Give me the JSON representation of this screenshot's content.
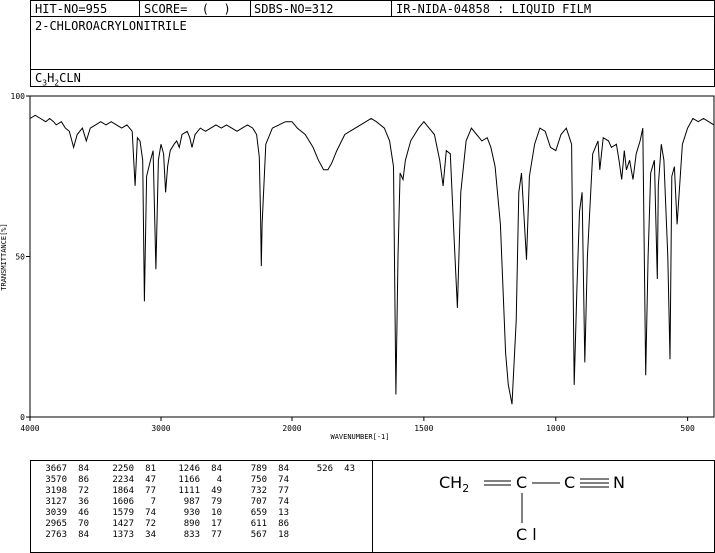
{
  "header": {
    "hit_no": "HIT-NO=955",
    "score": "SCORE=  (  )",
    "sdbs_no": "SDBS-NO=312",
    "ir_label": "IR-NIDA-04858 : LIQUID FILM",
    "compound_name": "2-CHLOROACRYLONITRILE",
    "formula": {
      "c": "C",
      "c_sub": "3",
      "h": "H",
      "h_sub": "2",
      "rest": "CLN"
    }
  },
  "chart_data": {
    "type": "line",
    "xlabel": "WAVENUMBER[-1]",
    "ylabel": "TRANSMITTANCE[%]",
    "xlim": [
      4000,
      400
    ],
    "ylim": [
      0,
      100
    ],
    "x_ticks": [
      4000,
      3000,
      2000,
      1500,
      1000,
      500
    ],
    "y_ticks": [
      0,
      50,
      100
    ],
    "series": [
      {
        "x": [
          4000,
          3960,
          3920,
          3880,
          3850,
          3820,
          3800,
          3760,
          3730,
          3700,
          3667,
          3640,
          3600,
          3570,
          3540,
          3500,
          3460,
          3420,
          3380,
          3340,
          3300,
          3260,
          3220,
          3198,
          3180,
          3160,
          3140,
          3127,
          3110,
          3080,
          3060,
          3039,
          3020,
          3000,
          2980,
          2965,
          2950,
          2930,
          2900,
          2880,
          2860,
          2840,
          2800,
          2780,
          2763,
          2740,
          2700,
          2660,
          2620,
          2580,
          2540,
          2500,
          2460,
          2420,
          2380,
          2340,
          2300,
          2270,
          2250,
          2240,
          2234,
          2228,
          2200,
          2150,
          2100,
          2050,
          2000,
          1980,
          1950,
          1920,
          1900,
          1880,
          1864,
          1850,
          1830,
          1800,
          1760,
          1720,
          1700,
          1680,
          1650,
          1630,
          1615,
          1606,
          1598,
          1590,
          1579,
          1570,
          1550,
          1520,
          1500,
          1480,
          1460,
          1440,
          1427,
          1415,
          1400,
          1385,
          1373,
          1360,
          1340,
          1320,
          1300,
          1280,
          1260,
          1246,
          1230,
          1210,
          1190,
          1180,
          1166,
          1150,
          1140,
          1130,
          1111,
          1100,
          1080,
          1060,
          1040,
          1020,
          1000,
          980,
          960,
          940,
          930,
          920,
          910,
          900,
          890,
          880,
          860,
          840,
          833,
          820,
          800,
          789,
          770,
          760,
          750,
          740,
          732,
          720,
          707,
          695,
          680,
          670,
          659,
          650,
          640,
          626,
          615,
          611,
          600,
          590,
          575,
          567,
          560,
          550,
          540,
          520,
          500,
          480,
          460,
          440,
          420,
          400
        ],
        "y": [
          93,
          94,
          93,
          92,
          93,
          92,
          91,
          92,
          90,
          89,
          84,
          88,
          90,
          86,
          90,
          91,
          92,
          91,
          92,
          91,
          90,
          91,
          89,
          72,
          87,
          86,
          80,
          36,
          75,
          80,
          83,
          46,
          80,
          85,
          82,
          70,
          78,
          83,
          85,
          86,
          84,
          88,
          89,
          87,
          84,
          88,
          90,
          89,
          90,
          91,
          90,
          91,
          90,
          89,
          90,
          91,
          90,
          88,
          81,
          62,
          47,
          60,
          85,
          90,
          91,
          92,
          92,
          90,
          88,
          84,
          80,
          77,
          77,
          79,
          83,
          88,
          90,
          92,
          93,
          92,
          90,
          86,
          78,
          7,
          50,
          76,
          74,
          80,
          86,
          90,
          92,
          90,
          88,
          80,
          72,
          83,
          82,
          55,
          34,
          70,
          86,
          90,
          88,
          86,
          87,
          84,
          78,
          60,
          20,
          10,
          4,
          30,
          70,
          76,
          49,
          75,
          85,
          90,
          89,
          84,
          83,
          88,
          90,
          85,
          10,
          40,
          64,
          70,
          17,
          50,
          82,
          86,
          77,
          87,
          86,
          84,
          85,
          80,
          74,
          83,
          77,
          80,
          74,
          82,
          86,
          90,
          13,
          50,
          76,
          80,
          43,
          72,
          85,
          80,
          50,
          18,
          75,
          78,
          60,
          85,
          90,
          93,
          92,
          93,
          92,
          91
        ]
      }
    ]
  },
  "peak_table": {
    "columns": [
      [
        [
          "3667",
          "84"
        ],
        [
          "3570",
          "86"
        ],
        [
          "3198",
          "72"
        ],
        [
          "3127",
          "36"
        ],
        [
          "3039",
          "46"
        ],
        [
          "2965",
          "70"
        ],
        [
          "2763",
          "84"
        ]
      ],
      [
        [
          "2250",
          "81"
        ],
        [
          "2234",
          "47"
        ],
        [
          "1864",
          "77"
        ],
        [
          "1606",
          "7"
        ],
        [
          "1579",
          "74"
        ],
        [
          "1427",
          "72"
        ],
        [
          "1373",
          "34"
        ]
      ],
      [
        [
          "1246",
          "84"
        ],
        [
          "1166",
          "4"
        ],
        [
          "1111",
          "49"
        ],
        [
          "987",
          "79"
        ],
        [
          "930",
          "10"
        ],
        [
          "890",
          "17"
        ],
        [
          "833",
          "77"
        ]
      ],
      [
        [
          "789",
          "84"
        ],
        [
          "750",
          "74"
        ],
        [
          "732",
          "77"
        ],
        [
          "707",
          "74"
        ],
        [
          "659",
          "13"
        ],
        [
          "611",
          "86"
        ],
        [
          "567",
          "18"
        ]
      ],
      [
        [
          "526",
          "43"
        ]
      ]
    ]
  },
  "structure": {
    "ch2": "CH",
    "ch2_sub": "2",
    "c": "C",
    "n": "N",
    "cl": "C l"
  }
}
